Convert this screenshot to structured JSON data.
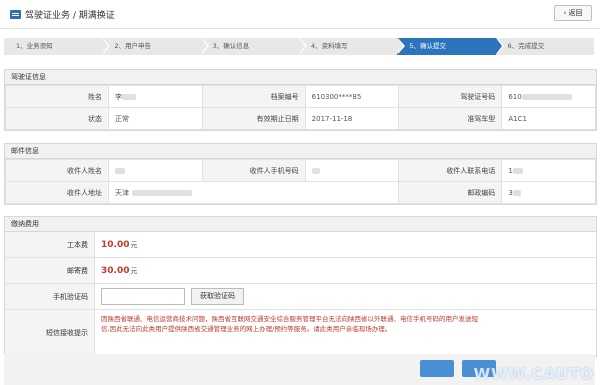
{
  "header": {
    "title": "驾驶证业务 / 期满换证",
    "back_label": "返回"
  },
  "steps": [
    {
      "label": "1、业务须知",
      "active": false
    },
    {
      "label": "2、用户申告",
      "active": false
    },
    {
      "label": "3、确认信息",
      "active": false
    },
    {
      "label": "4、资料填写",
      "active": false
    },
    {
      "label": "5、确认提交",
      "active": true
    },
    {
      "label": "6、完成提交",
      "active": false
    }
  ],
  "license_info": {
    "section_title": "驾驶证信息",
    "name_label": "姓名",
    "name_value": "李",
    "file_no_label": "档案编号",
    "file_no_value": "610300****85",
    "license_no_label": "驾驶证号码",
    "license_no_value": "610",
    "status_label": "状态",
    "status_value": "正常",
    "expiry_label": "有效期止日期",
    "expiry_value": "2017-11-18",
    "vehicle_label": "准驾车型",
    "vehicle_value": "A1C1"
  },
  "mail_info": {
    "section_title": "邮件信息",
    "recipient_label": "收件人姓名",
    "recipient_value": "",
    "phone_label": "收件人手机号码",
    "phone_value": "",
    "contact_label": "收件人联系电话",
    "contact_value": "1",
    "address_label": "收件人地址",
    "address_value": "天津",
    "postcode_label": "邮政编码",
    "postcode_value": "3"
  },
  "fees": {
    "section_title": "缴纳费用",
    "cost_label": "工本费",
    "cost_value": "10.00",
    "cost_unit": "元",
    "postage_label": "邮寄费",
    "postage_value": "30.00",
    "postage_unit": "元",
    "code_label": "手机验证码",
    "code_placeholder": "",
    "get_code_label": "获取验证码",
    "sms_label": "短信接收提示",
    "sms_notice": "因陕西省联通、电信运营商技术问题，陕西省互联网交通安全综合服务管理平台无法向陕西省以外联通、电信手机号码的用户发送短信,因此无法向此类用户提供陕西省交通管理业务的网上办理/预约等服务。请此类用户亲临现场办理。"
  },
  "footer": {
    "watermark": "WWW.CAUTO"
  },
  "colors": {
    "accent": "#2c74bd",
    "money": "#c0392b",
    "button": "#4a8fd3"
  }
}
